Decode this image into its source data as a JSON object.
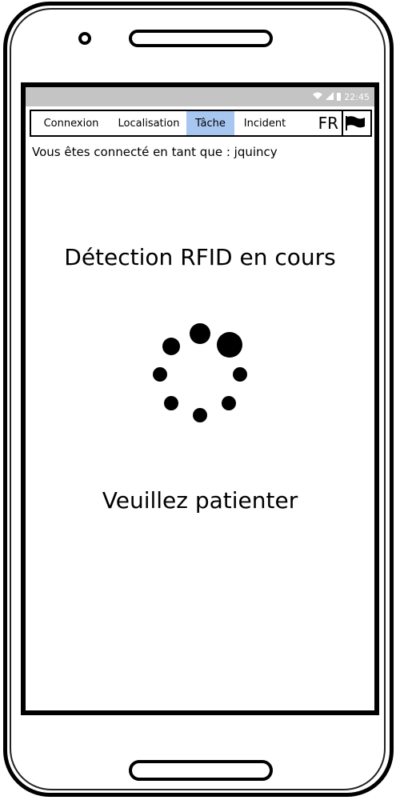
{
  "status_bar": {
    "time": "22:45",
    "wifi_icon": "wifi-icon",
    "signal_icon": "signal-icon",
    "battery_icon": "battery-icon"
  },
  "nav": {
    "tabs": [
      {
        "label": "Connexion",
        "active": false
      },
      {
        "label": "Localisation",
        "active": false
      },
      {
        "label": "Tâche",
        "active": true
      },
      {
        "label": "Incident",
        "active": false
      }
    ],
    "language": "FR",
    "flag_icon": "flag-icon",
    "active_color": "#a7c6f0"
  },
  "user": {
    "connected_text": "Vous êtes connecté en tant que : jquincy"
  },
  "main": {
    "title": "Détection RFID en cours",
    "spinner_icon": "loading-spinner-icon",
    "wait_text": "Veuillez patienter"
  }
}
